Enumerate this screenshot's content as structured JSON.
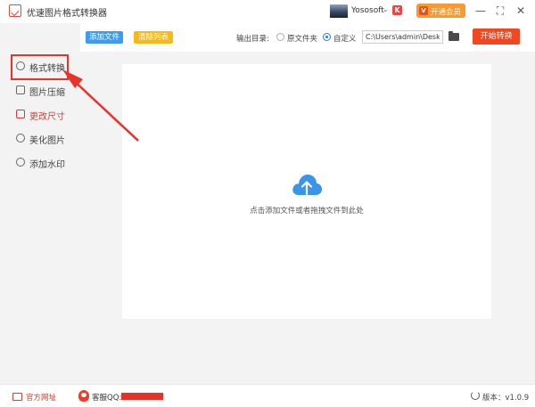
{
  "app": {
    "title": "优速图片格式转换器",
    "user_name": "Yososoft",
    "vip_badge": "K",
    "vip_button_icon": "V",
    "vip_button_label": "开通会员",
    "minimize_symbol": "—",
    "maximize_symbol": "⛶",
    "close_symbol": "✕",
    "chevron": "⌄"
  },
  "sidebar": {
    "items": [
      {
        "label": "格式转换",
        "icon": "format-convert-icon",
        "active": false
      },
      {
        "label": "图片压缩",
        "icon": "compress-icon",
        "active": false
      },
      {
        "label": "更改尺寸",
        "icon": "resize-icon",
        "active": true
      },
      {
        "label": "美化图片",
        "icon": "beautify-icon",
        "active": false
      },
      {
        "label": "添加水印",
        "icon": "watermark-icon",
        "active": false
      }
    ]
  },
  "toolbar": {
    "add_files": "添加文件",
    "clear_list": "清除列表",
    "output_label": "输出目录:",
    "option_original": "原文件夹",
    "option_custom": "自定义",
    "selected_option": "自定义",
    "output_path": "C:\\Users\\admin\\Deskto",
    "start_button": "开始转换"
  },
  "dropzone": {
    "hint": "点击添加文件或者拖拽文件到此处",
    "icon": "cloud-upload-icon"
  },
  "statusbar": {
    "official_site": "官方网址",
    "support_qq": "客服QQ:",
    "version": "版本：v1.0.9"
  },
  "colors": {
    "accent_red": "#e0392d",
    "primary_blue": "#3d9cf0",
    "clear_yellow": "#f7b81c",
    "start_orange": "#f2471f",
    "vip_orange": "#f79a33",
    "cloud_blue": "#3a95e8"
  }
}
